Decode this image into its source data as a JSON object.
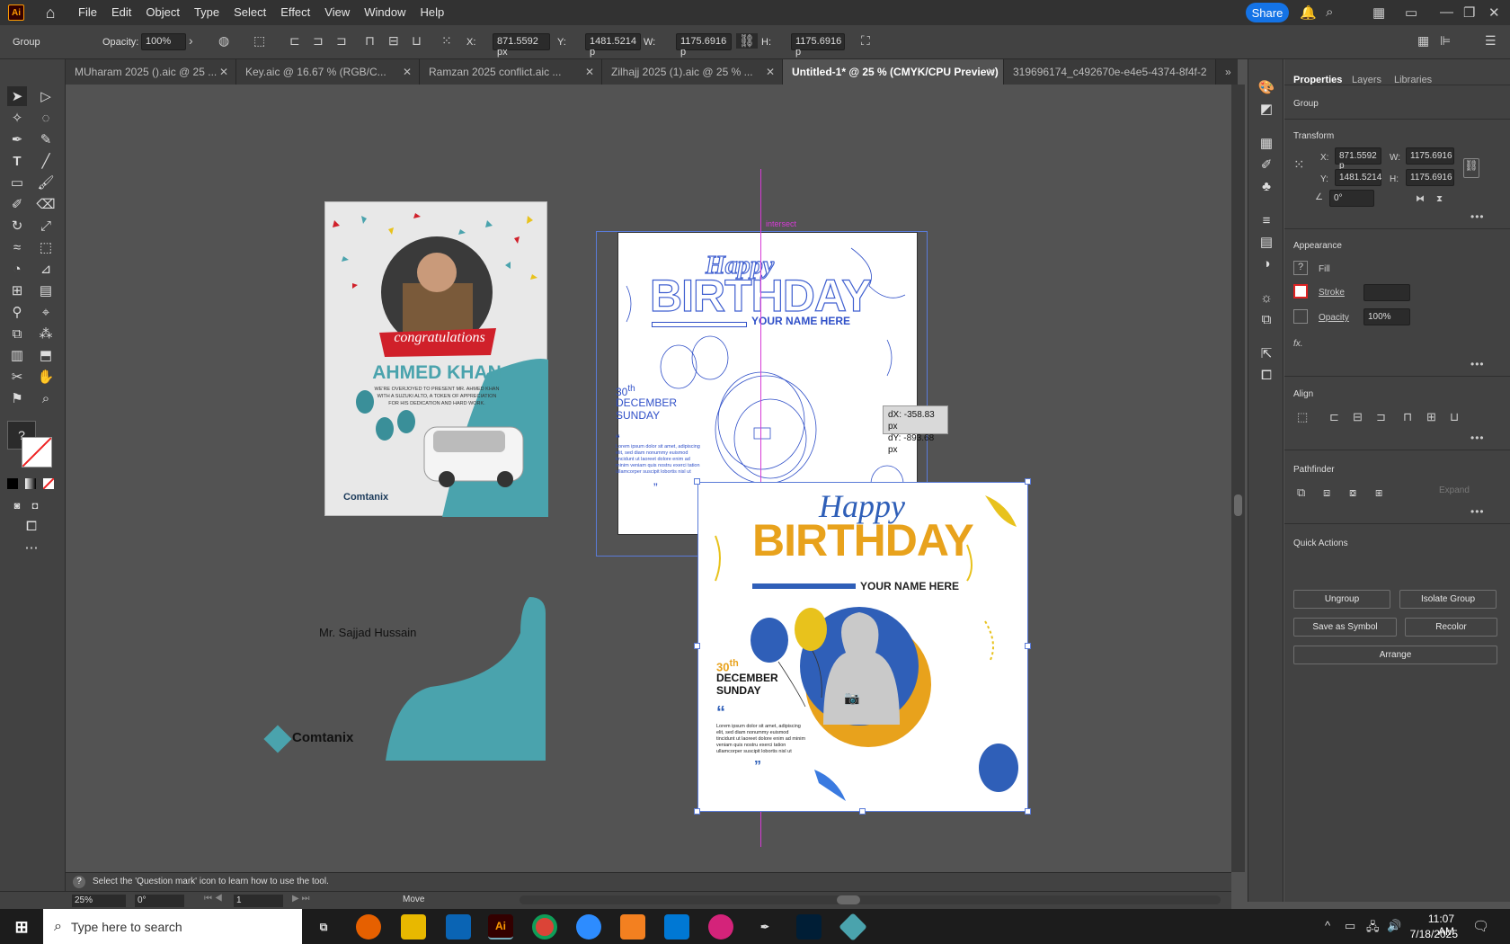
{
  "menubar": {
    "items": [
      "File",
      "Edit",
      "Object",
      "Type",
      "Select",
      "Effect",
      "View",
      "Window",
      "Help"
    ],
    "share_label": "Share",
    "app_badge": "Ai"
  },
  "control": {
    "selection": "Group",
    "opacity_label": "Opacity:",
    "opacity_value": "100%",
    "x_label": "X:",
    "x_value": "871.5592 px",
    "y_label": "Y:",
    "y_value": "1481.5214 p",
    "w_label": "W:",
    "w_value": "1175.6916 p",
    "h_label": "H:",
    "h_value": "1175.6916 p"
  },
  "tabs": [
    {
      "label": "MUharam 2025 ().aic @ 25 ..."
    },
    {
      "label": "Key.aic @ 16.67 % (RGB/C..."
    },
    {
      "label": "Ramzan 2025 conflict.aic ..."
    },
    {
      "label": "Zilhajj 2025 (1).aic @ 25 % ..."
    },
    {
      "label": "Untitled-1* @ 25 % (CMYK/CPU Preview)"
    },
    {
      "label": "319696174_c492670e-e4e5-4374-8f4f-2"
    }
  ],
  "canvas": {
    "smart_guide": "intersect",
    "dx": "dX: -358.83 px",
    "dy": "dY: -893.68 px",
    "art_congrats": {
      "ribbon": "congratulations",
      "name": "AHMED KHAN",
      "line1": "WE'RE OVERJOYED TO PRESENT MR. AHMED KHAN",
      "line2": "WITH A SUZUKI ALTO, A TOKEN OF APPRECIATION",
      "line3": "FOR HIS DEDICATION AND HARD WORK.",
      "brand": "Comtanix"
    },
    "loose_text": "Mr. Sajjad Hussain",
    "loose_brand": "Comtanix",
    "birthday": {
      "script": "Happy",
      "title": "BIRTHDAY",
      "subtitle": "YOUR NAME HERE",
      "day_num": "30",
      "day_sup": "th",
      "month": "DECEMBER",
      "weekday": "SUNDAY",
      "quote_mark": "“",
      "close_mark": "”",
      "lorem": "Lorem ipsum dolor sit amet, adipiscing elit, sed diam nonummy euismod tincidunt ut laoreet dolore enim ad minim veniam quis nostru exerci tation ullamcorper suscipit lobortis nisl ut"
    }
  },
  "properties": {
    "tabs": [
      "Properties",
      "Layers",
      "Libraries"
    ],
    "selection": "Group",
    "transform": {
      "title": "Transform",
      "x_label": "X:",
      "x": "871.5592 p",
      "y_label": "Y:",
      "y": "1481.5214",
      "w_label": "W:",
      "w": "1175.6916",
      "h_label": "H:",
      "h": "1175.6916",
      "angle": "0°"
    },
    "appearance": {
      "title": "Appearance",
      "fill": "Fill",
      "stroke": "Stroke",
      "opacity": "Opacity",
      "opacity_value": "100%",
      "fx": "fx."
    },
    "align_title": "Align",
    "pathfinder_title": "Pathfinder",
    "expand": "Expand",
    "quick_actions": {
      "title": "Quick Actions",
      "ungroup": "Ungroup",
      "isolate": "Isolate Group",
      "symbol": "Save as Symbol",
      "recolor": "Recolor",
      "arrange": "Arrange"
    }
  },
  "status": {
    "hint": "Select the 'Question mark' icon to learn how to use the tool.",
    "zoom": "25%",
    "rotate": "0°",
    "artboard": "1",
    "tool": "Move"
  },
  "taskbar": {
    "search_placeholder": "Type here to search",
    "time": "11:07 AM",
    "date": "7/18/2025"
  },
  "colors": {
    "accent": "#1473e6",
    "teal": "#4aa3ad",
    "orange": "#e8a21c",
    "blue": "#2f5fb8",
    "ribbon": "#d0202a",
    "magenta_guide": "#d63bd6"
  }
}
